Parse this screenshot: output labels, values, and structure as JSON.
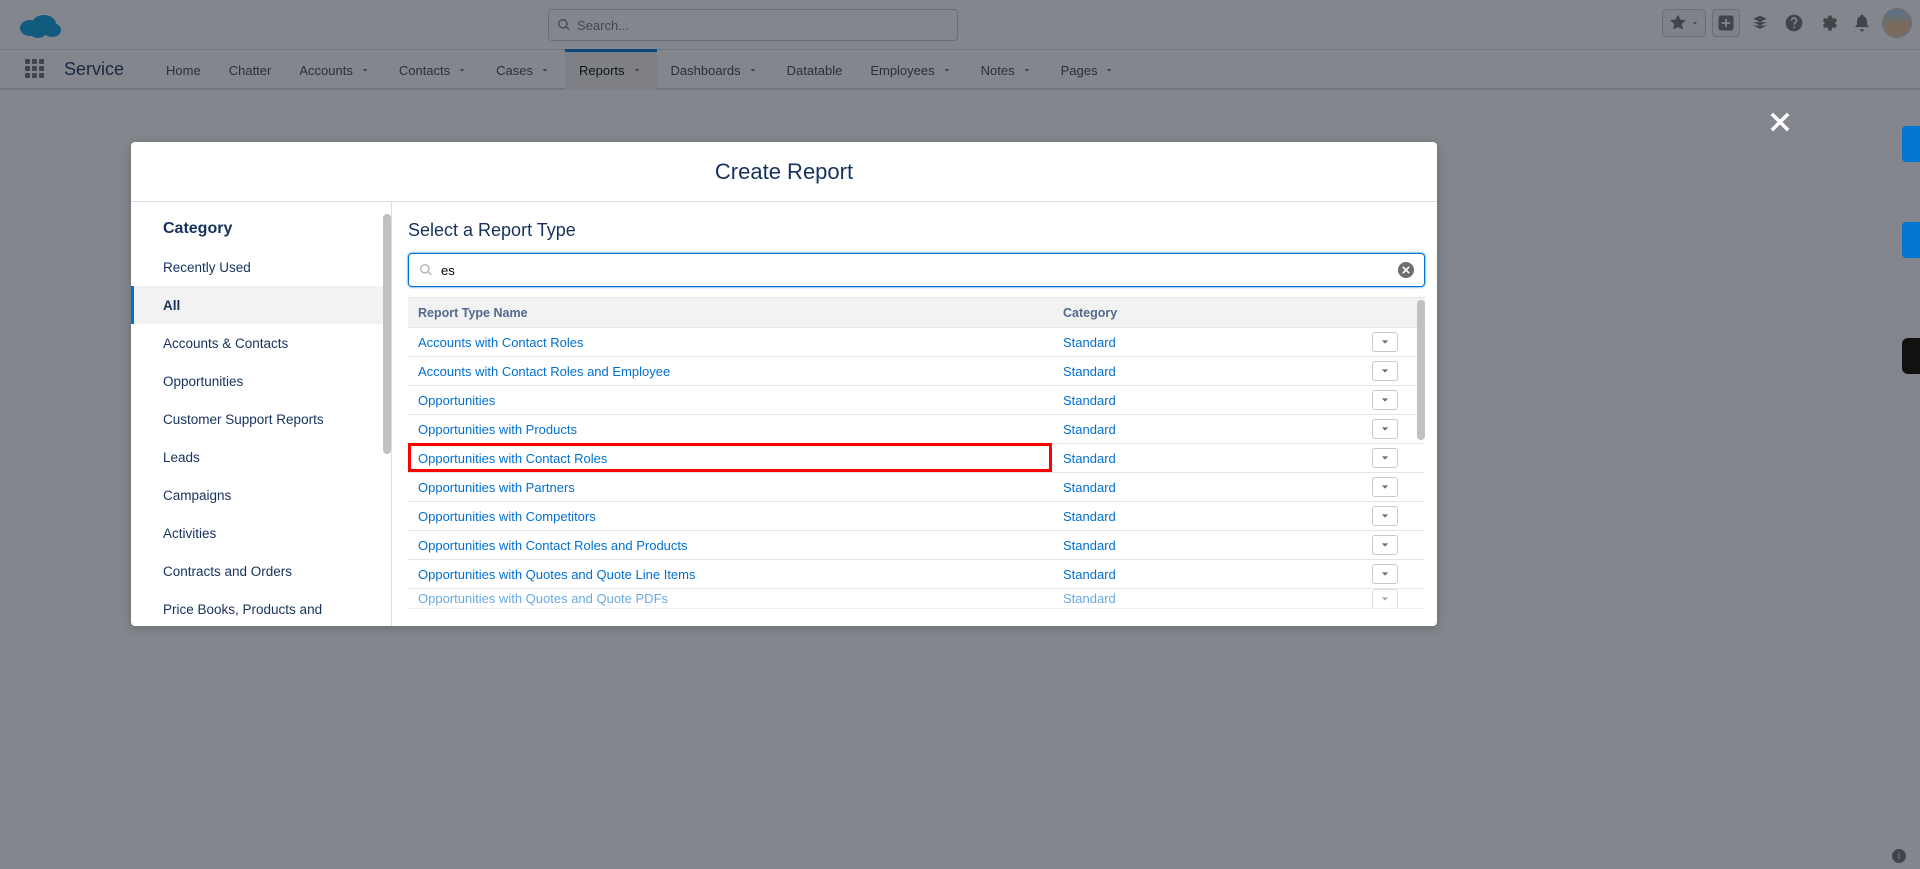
{
  "header": {
    "search_placeholder": "Search..."
  },
  "nav": {
    "app_name": "Service",
    "items": [
      {
        "label": "Home",
        "has_menu": false
      },
      {
        "label": "Chatter",
        "has_menu": false
      },
      {
        "label": "Accounts",
        "has_menu": true
      },
      {
        "label": "Contacts",
        "has_menu": true
      },
      {
        "label": "Cases",
        "has_menu": true
      },
      {
        "label": "Reports",
        "has_menu": true,
        "active": true
      },
      {
        "label": "Dashboards",
        "has_menu": true
      },
      {
        "label": "Datatable",
        "has_menu": false
      },
      {
        "label": "Employees",
        "has_menu": true
      },
      {
        "label": "Notes",
        "has_menu": true
      },
      {
        "label": "Pages",
        "has_menu": true
      }
    ]
  },
  "modal": {
    "title": "Create Report",
    "sidebar_title": "Category",
    "categories": [
      "Recently Used",
      "All",
      "Accounts & Contacts",
      "Opportunities",
      "Customer Support Reports",
      "Leads",
      "Campaigns",
      "Activities",
      "Contracts and Orders",
      "Price Books, Products and"
    ],
    "selected_category_index": 1,
    "main_heading": "Select a Report Type",
    "search_value": "es",
    "columns": {
      "name": "Report Type Name",
      "category": "Category"
    },
    "rows": [
      {
        "name": "Accounts with Contact Roles",
        "category": "Standard"
      },
      {
        "name": "Accounts with Contact Roles and Employee",
        "category": "Standard"
      },
      {
        "name": "Opportunities",
        "category": "Standard"
      },
      {
        "name": "Opportunities with Products",
        "category": "Standard"
      },
      {
        "name": "Opportunities with Contact Roles",
        "category": "Standard",
        "highlighted": true
      },
      {
        "name": "Opportunities with Partners",
        "category": "Standard"
      },
      {
        "name": "Opportunities with Competitors",
        "category": "Standard"
      },
      {
        "name": "Opportunities with Contact Roles and Products",
        "category": "Standard"
      },
      {
        "name": "Opportunities with Quotes and Quote Line Items",
        "category": "Standard"
      },
      {
        "name": "Opportunities with Quotes and Quote PDFs",
        "category": "Standard"
      }
    ]
  }
}
